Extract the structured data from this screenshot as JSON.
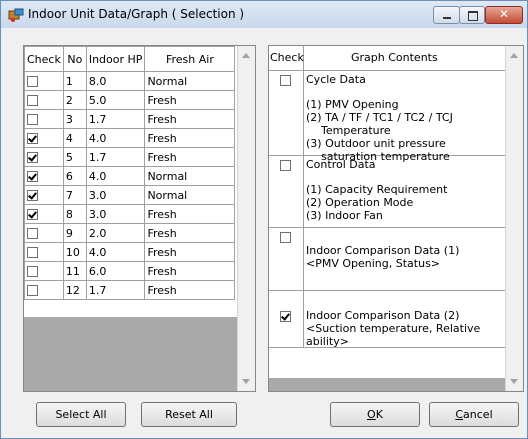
{
  "window": {
    "title": "Indoor Unit Data/Graph ( Selection )",
    "close_glyph": "✕"
  },
  "indoor_table": {
    "headers": [
      "Check",
      "No",
      "Indoor HP",
      "Fresh Air"
    ],
    "rows": [
      {
        "checked": false,
        "no": "1",
        "hp": "8.0",
        "air": "Normal"
      },
      {
        "checked": false,
        "no": "2",
        "hp": "5.0",
        "air": "Fresh"
      },
      {
        "checked": false,
        "no": "3",
        "hp": "1.7",
        "air": "Fresh"
      },
      {
        "checked": true,
        "no": "4",
        "hp": "4.0",
        "air": "Fresh"
      },
      {
        "checked": true,
        "no": "5",
        "hp": "1.7",
        "air": "Fresh"
      },
      {
        "checked": true,
        "no": "6",
        "hp": "4.0",
        "air": "Normal"
      },
      {
        "checked": true,
        "no": "7",
        "hp": "3.0",
        "air": "Normal"
      },
      {
        "checked": true,
        "no": "8",
        "hp": "3.0",
        "air": "Fresh"
      },
      {
        "checked": false,
        "no": "9",
        "hp": "2.0",
        "air": "Fresh"
      },
      {
        "checked": false,
        "no": "10",
        "hp": "4.0",
        "air": "Fresh"
      },
      {
        "checked": false,
        "no": "11",
        "hp": "6.0",
        "air": "Fresh"
      },
      {
        "checked": false,
        "no": "12",
        "hp": "1.7",
        "air": "Fresh"
      }
    ]
  },
  "graph_table": {
    "headers": [
      "Check",
      "Graph Contents"
    ],
    "items": [
      {
        "checked": false,
        "title": "Cycle Data",
        "lines": [
          {
            "text": "(1) PMV Opening",
            "indent": false
          },
          {
            "text": "(2) TA / TF / TC1 / TC2 / TCJ",
            "indent": false
          },
          {
            "text": "Temperature",
            "indent": true
          },
          {
            "text": "(3) Outdoor unit pressure",
            "indent": false
          },
          {
            "text": "saturation temperature",
            "indent": true
          }
        ]
      },
      {
        "checked": false,
        "title": "Control Data",
        "lines": [
          {
            "text": "(1) Capacity Requirement",
            "indent": false
          },
          {
            "text": "(2) Operation Mode",
            "indent": false
          },
          {
            "text": "(3) Indoor Fan",
            "indent": false
          }
        ]
      },
      {
        "checked": false,
        "title": "Indoor Comparison Data (1)",
        "lines": [
          {
            "text": "<PMV Opening, Status>",
            "indent": false
          }
        ]
      },
      {
        "checked": true,
        "title": "Indoor Comparison Data (2)",
        "lines": [
          {
            "text": "<Suction temperature, Relative",
            "indent": false
          },
          {
            "text": "ability>",
            "indent": false
          }
        ]
      }
    ]
  },
  "buttons": {
    "select_all": "Select All",
    "reset_all": "Reset All",
    "ok_mnemonic": "O",
    "ok_rest": "K",
    "cancel_mnemonic": "C",
    "cancel_rest": "ancel"
  }
}
